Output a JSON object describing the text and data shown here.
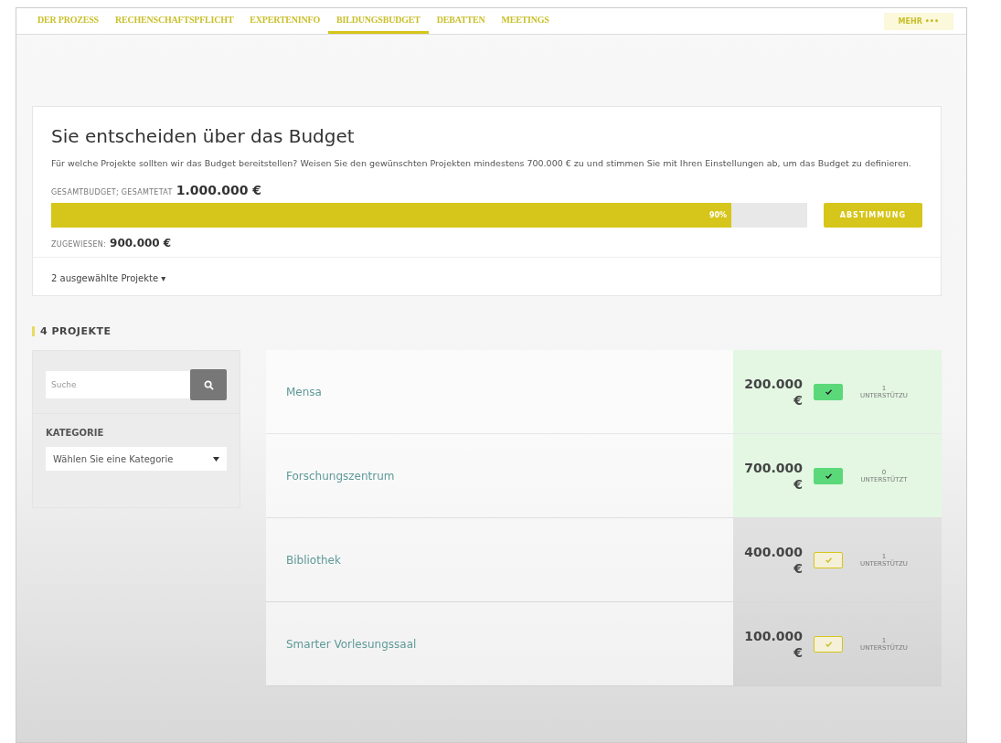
{
  "nav": {
    "tabs": [
      {
        "label": "DER PROZESS",
        "selected": false
      },
      {
        "label": "RECHENSCHAFTSPFLICHT",
        "selected": false
      },
      {
        "label": "EXPERTENINFO",
        "selected": false
      },
      {
        "label": "BILDUNGSBUDGET",
        "selected": true
      },
      {
        "label": "DEBATTEN",
        "selected": false
      },
      {
        "label": "MEETINGS",
        "selected": false
      }
    ],
    "more": "MEHR •••"
  },
  "budget": {
    "title": "Sie entscheiden über das Budget",
    "description": "Für welche Projekte sollten wir das Budget bereitstellen? Weisen Sie den gewünschten Projekten mindestens 700.000 € zu und stimmen Sie mit Ihren Einstellungen ab, um das Budget zu definieren.",
    "total_label": "GESAMTBUDGET; GESAMTETAT",
    "total_value": "1.000.000 €",
    "progress": {
      "level": 0.9,
      "reading": "90%"
    },
    "vote_button": "ABSTIMMUNG",
    "assigned_label": "ZUGEWIESEN:",
    "assigned_value": "900.000 €",
    "selected_toggle": "2 ausgewählte Projekte ▾"
  },
  "projects": {
    "heading": "4 PROJEKTE",
    "search": {
      "placeholder": "Suche"
    },
    "category_label": "KATEGORIE",
    "category_select": "Wählen Sie eine Kategorie",
    "items": [
      {
        "name": "Mensa",
        "amount": "200.000",
        "currency": "€",
        "selected": true,
        "support_count": "1",
        "support_label": "UNTERSTÜTZU"
      },
      {
        "name": "Forschungszentrum",
        "amount": "700.000",
        "currency": "€",
        "selected": true,
        "support_count": "0",
        "support_label": "UNTERSTÜTZT"
      },
      {
        "name": "Bibliothek",
        "amount": "400.000",
        "currency": "€",
        "selected": false,
        "support_count": "1",
        "support_label": "UNTERSTÜTZU"
      },
      {
        "name": "Smarter Vorlesungssaal",
        "amount": "100.000",
        "currency": "€",
        "selected": false,
        "support_count": "1",
        "support_label": "UNTERSTÜTZU"
      }
    ]
  }
}
